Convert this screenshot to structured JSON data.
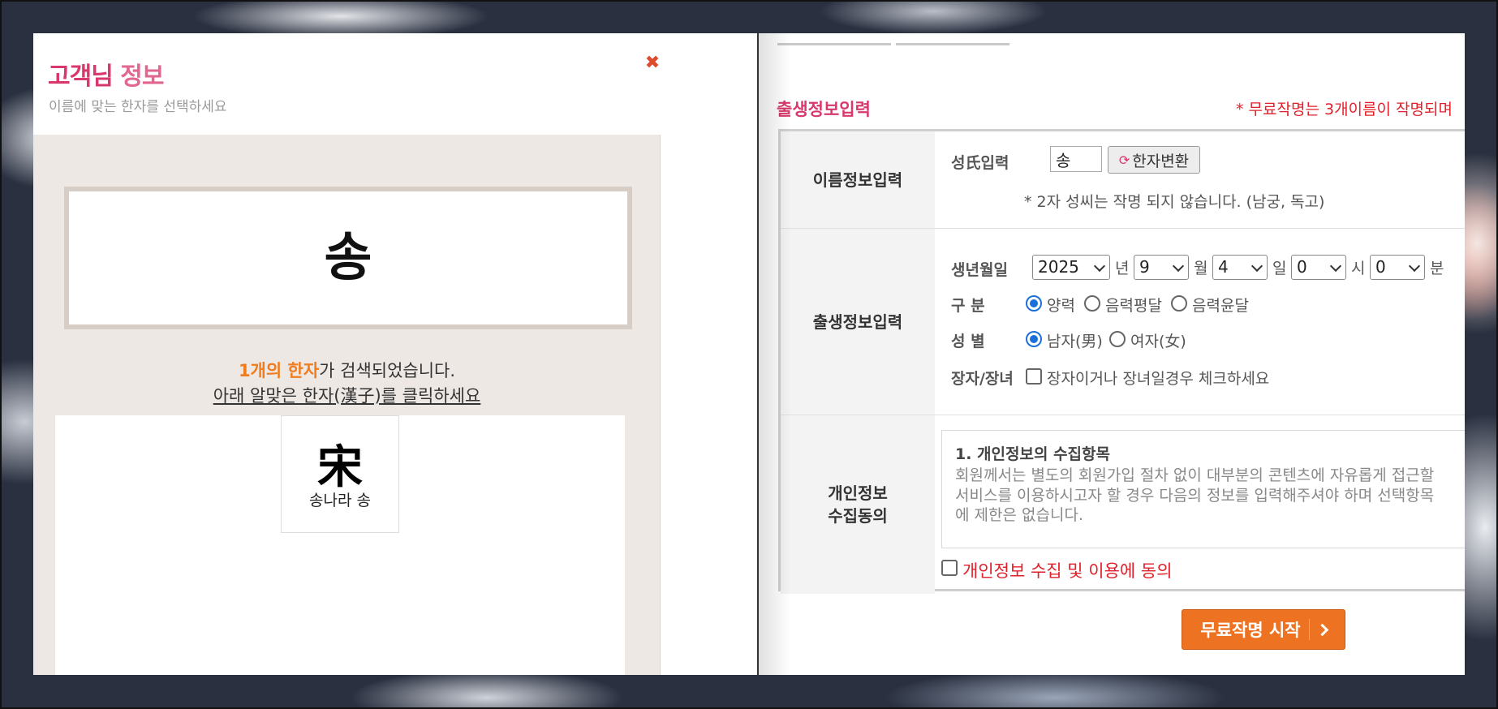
{
  "modal": {
    "title_part1": "고객님",
    "title_part2": "정보",
    "subtitle": "이름에 맞는 한자를 선택하세요",
    "close_icon": "close-icon",
    "surname": "송",
    "result_count": "1개의 한자",
    "result_suffix": "가 검색되었습니다.",
    "instruction": "아래 알맞은 한자(漢子)를 클릭하세요",
    "hanja_options": [
      {
        "char": "宋",
        "meaning": "송나라 송"
      }
    ]
  },
  "form": {
    "section_title": "출생정보입력",
    "free_note": "* 무료작명는 3개이름이 작명되며",
    "name_row": {
      "header": "이름정보입력",
      "surname_label": "성氏입력",
      "surname_value": "송",
      "hanja_button": "한자변환",
      "note": "* 2자 성씨는 작명 되지 않습니다. (남궁, 독고)"
    },
    "birth_row": {
      "header": "출생정보입력",
      "date_label": "생년월일",
      "year": "2025",
      "year_unit": "년",
      "month": "9",
      "month_unit": "월",
      "day": "4",
      "day_unit": "일",
      "hour": "0",
      "hour_unit": "시",
      "minute": "0",
      "minute_unit": "분",
      "calendar_label": "구 분",
      "calendar_options": [
        "양력",
        "음력평달",
        "음력윤달"
      ],
      "calendar_selected": "양력",
      "gender_label": "성 별",
      "gender_options": [
        "남자(男)",
        "여자(女)"
      ],
      "gender_selected": "남자(男)",
      "eldest_label": "장자/장녀",
      "eldest_text": "장자이거나 장녀일경우 체크하세요"
    },
    "privacy_row": {
      "header_line1": "개인정보",
      "header_line2": "수집동의",
      "box_heading": "1. 개인정보의 수집항목",
      "box_lines": [
        "회원께서는 별도의 회원가입 절차 없이 대부분의 콘텐츠에 자유롭게 접근할",
        "서비스를 이용하시고자 할 경우 다음의 정보를 입력해주셔야 하며 선택항목",
        "에 제한은 없습니다."
      ],
      "agree_text": "개인정보 수집 및 이용에 동의"
    },
    "start_button": "무료작명 시작"
  },
  "colors": {
    "brand_pink": "#d8386c",
    "accent_orange": "#ed7221",
    "warning_red": "#e0212b",
    "radio_blue": "#1a6fd9"
  }
}
